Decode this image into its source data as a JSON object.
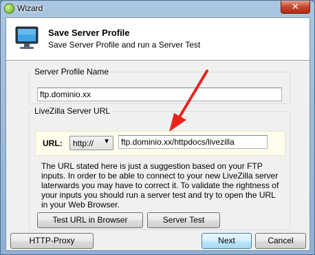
{
  "window": {
    "title": "Wizard",
    "close_label": "✕"
  },
  "header": {
    "title": "Save Server Profile",
    "subtitle": "Save Server Profile and run a Server Test"
  },
  "profile": {
    "legend": "Server Profile Name",
    "value": "ftp.dominio.xx"
  },
  "server_url": {
    "legend": "LiveZilla Server URL",
    "url_label": "URL:",
    "protocol_selected": "http://",
    "url_value": "ftp.dominio.xx/httpdocs/livezilla",
    "help_text": "The URL stated here is just a suggestion based on your FTP inputs. In order to be able to connect to your new LiveZilla server laterwards you may have to correct it. To validate the rightness of your inputs you should run a server test and try to open the URL in your Web Browser.",
    "test_url_button": "Test URL in Browser",
    "server_test_button": "Server Test"
  },
  "footer": {
    "proxy_button": "HTTP-Proxy",
    "next_button": "Next",
    "cancel_button": "Cancel"
  },
  "annotation": {
    "arrow_color": "#e8241c"
  }
}
